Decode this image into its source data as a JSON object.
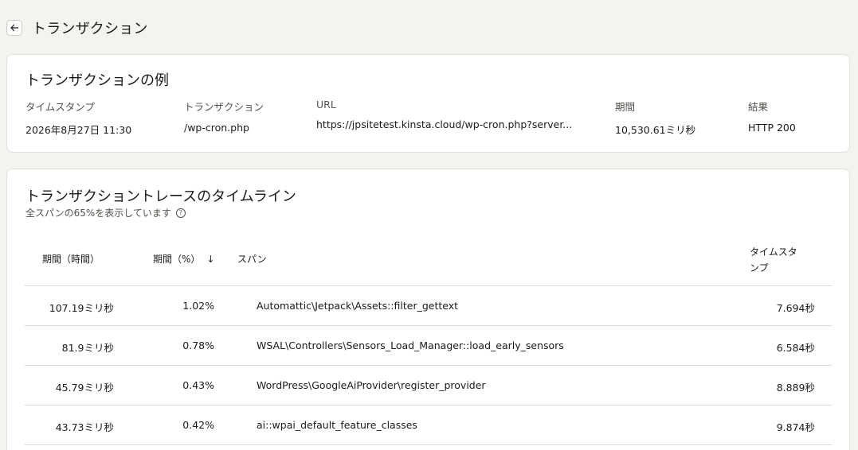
{
  "header": {
    "title": "トランザクション"
  },
  "example": {
    "title": "トランザクションの例",
    "fields": [
      {
        "label": "タイムスタンプ",
        "value": "2026年8月27日 11:30"
      },
      {
        "label": "トランザクション",
        "value": "/wp-cron.php"
      },
      {
        "label": "URL",
        "value": "https://jpsitetest.kinsta.cloud/wp-cron.php?server..."
      },
      {
        "label": "期間",
        "value": "10,530.61ミリ秒"
      },
      {
        "label": "結果",
        "value": "HTTP 200"
      }
    ]
  },
  "timeline": {
    "title": "トランザクショントレースのタイムライン",
    "subtitle": "全スパンの65%を表示しています",
    "columns": {
      "duration": "期間（時間）",
      "percent": "期間（%）",
      "span": "スパン",
      "timestamp_line1": "タイムスタ",
      "timestamp_line2": "ンプ"
    },
    "rows": [
      {
        "duration": "107.19ミリ秒",
        "percent": "1.02%",
        "span": "Automattic\\Jetpack\\Assets::filter_gettext",
        "timestamp": "7.694秒"
      },
      {
        "duration": "81.9ミリ秒",
        "percent": "0.78%",
        "span": "WSAL\\Controllers\\Sensors_Load_Manager::load_early_sensors",
        "timestamp": "6.584秒"
      },
      {
        "duration": "45.79ミリ秒",
        "percent": "0.43%",
        "span": "WordPress\\GoogleAiProvider\\register_provider",
        "timestamp": "8.889秒"
      },
      {
        "duration": "43.73ミリ秒",
        "percent": "0.42%",
        "span": "ai::wpai_default_feature_classes",
        "timestamp": "9.874秒"
      }
    ]
  }
}
